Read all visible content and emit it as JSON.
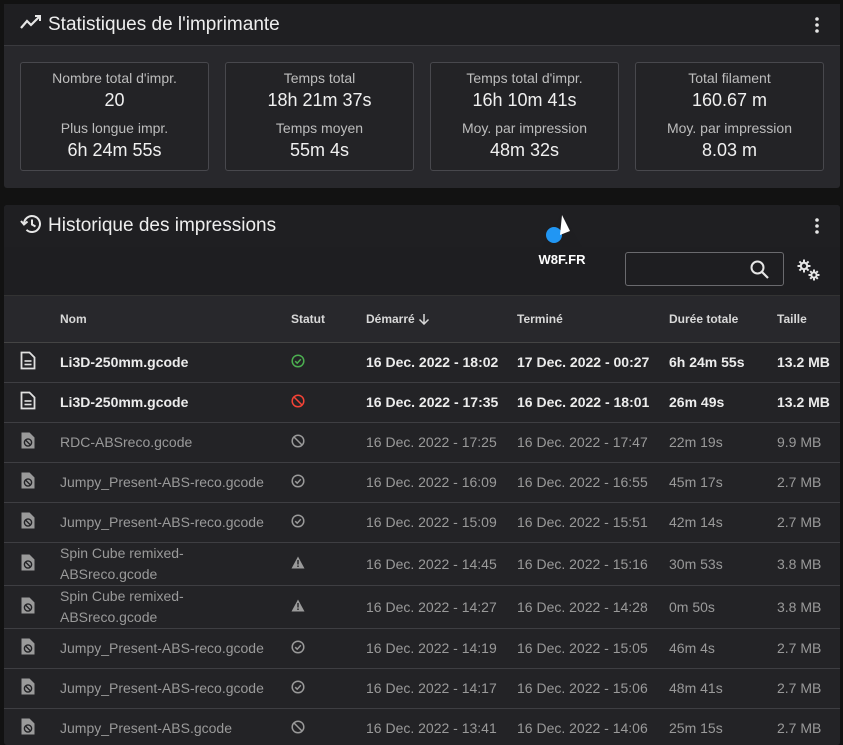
{
  "stats": {
    "title": "Statistiques de l'imprimante",
    "cards": [
      {
        "label1": "Nombre total d'impr.",
        "value1": "20",
        "label2": "Plus longue impr.",
        "value2": "6h 24m 55s"
      },
      {
        "label1": "Temps total",
        "value1": "18h 21m 37s",
        "label2": "Temps moyen",
        "value2": "55m 4s"
      },
      {
        "label1": "Temps total d'impr.",
        "value1": "16h 10m 41s",
        "label2": "Moy. par impression",
        "value2": "48m 32s"
      },
      {
        "label1": "Total filament",
        "value1": "160.67 m",
        "label2": "Moy. par impression",
        "value2": "8.03 m"
      }
    ]
  },
  "history": {
    "title": "Historique des impressions",
    "search_placeholder": "",
    "watermark": "W8F.FR",
    "columns": {
      "name": "Nom",
      "status": "Statut",
      "started": "Démarré",
      "ended": "Terminé",
      "duration": "Durée totale",
      "size": "Taille"
    },
    "rows": [
      {
        "name": "Li3D-250mm.gcode",
        "status": "completed",
        "started": "16 Dec. 2022 - 18:02",
        "ended": "17 Dec. 2022 - 00:27",
        "duration": "6h 24m 55s",
        "size": "13.2 MB",
        "style": "bold"
      },
      {
        "name": "Li3D-250mm.gcode",
        "status": "cancelled",
        "started": "16 Dec. 2022 - 17:35",
        "ended": "16 Dec. 2022 - 18:01",
        "duration": "26m 49s",
        "size": "13.2 MB",
        "style": "bold"
      },
      {
        "name": "RDC-ABSreco.gcode",
        "status": "cancelled",
        "started": "16 Dec. 2022 - 17:25",
        "ended": "16 Dec. 2022 - 17:47",
        "duration": "22m 19s",
        "size": "9.9 MB",
        "style": "dim"
      },
      {
        "name": "Jumpy_Present-ABS-reco.gcode",
        "status": "completed",
        "started": "16 Dec. 2022 - 16:09",
        "ended": "16 Dec. 2022 - 16:55",
        "duration": "45m 17s",
        "size": "2.7 MB",
        "style": "dim"
      },
      {
        "name": "Jumpy_Present-ABS-reco.gcode",
        "status": "completed",
        "started": "16 Dec. 2022 - 15:09",
        "ended": "16 Dec. 2022 - 15:51",
        "duration": "42m 14s",
        "size": "2.7 MB",
        "style": "dim"
      },
      {
        "name": "Spin Cube remixed-\nABSreco.gcode",
        "status": "warning",
        "started": "16 Dec. 2022 - 14:45",
        "ended": "16 Dec. 2022 - 15:16",
        "duration": "30m 53s",
        "size": "3.8 MB",
        "style": "dim"
      },
      {
        "name": "Spin Cube remixed-\nABSreco.gcode",
        "status": "warning",
        "started": "16 Dec. 2022 - 14:27",
        "ended": "16 Dec. 2022 - 14:28",
        "duration": "0m 50s",
        "size": "3.8 MB",
        "style": "dim"
      },
      {
        "name": "Jumpy_Present-ABS-reco.gcode",
        "status": "completed",
        "started": "16 Dec. 2022 - 14:19",
        "ended": "16 Dec. 2022 - 15:05",
        "duration": "46m 4s",
        "size": "2.7 MB",
        "style": "dim"
      },
      {
        "name": "Jumpy_Present-ABS-reco.gcode",
        "status": "completed",
        "started": "16 Dec. 2022 - 14:17",
        "ended": "16 Dec. 2022 - 15:06",
        "duration": "48m 41s",
        "size": "2.7 MB",
        "style": "dim"
      },
      {
        "name": "Jumpy_Present-ABS.gcode",
        "status": "cancelled",
        "started": "16 Dec. 2022 - 13:41",
        "ended": "16 Dec. 2022 - 14:06",
        "duration": "25m 15s",
        "size": "2.7 MB",
        "style": "dim"
      }
    ]
  },
  "colors": {
    "success": "#4caf50",
    "error": "#f44336",
    "neutral_icon": "#9a9a9a",
    "bold_icon": "#e0e0e0"
  }
}
